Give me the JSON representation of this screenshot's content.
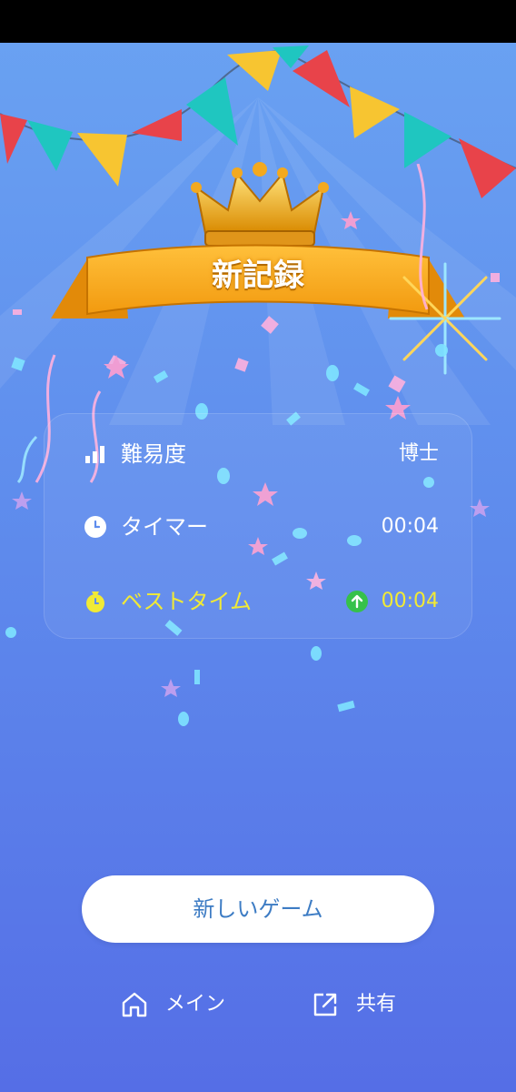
{
  "banner": {
    "title": "新記録"
  },
  "stats": {
    "difficulty": {
      "label": "難易度",
      "value": "博士",
      "icon": "signal-bars-icon"
    },
    "timer": {
      "label": "タイマー",
      "value": "00:04",
      "icon": "clock-icon"
    },
    "best_time": {
      "label": "ベストタイム",
      "value": "00:04",
      "icon": "stopwatch-icon",
      "trend_icon": "arrow-up-circle-icon"
    }
  },
  "actions": {
    "new_game": "新しいゲーム",
    "home": {
      "label": "メイン",
      "icon": "home-icon"
    },
    "share": {
      "label": "共有",
      "icon": "share-icon"
    }
  },
  "colors": {
    "background_top": "#6aa3f2",
    "background_bottom": "#556ee6",
    "highlight": "#f1ea35",
    "button_text": "#3d7cc4",
    "success": "#36c14a"
  }
}
